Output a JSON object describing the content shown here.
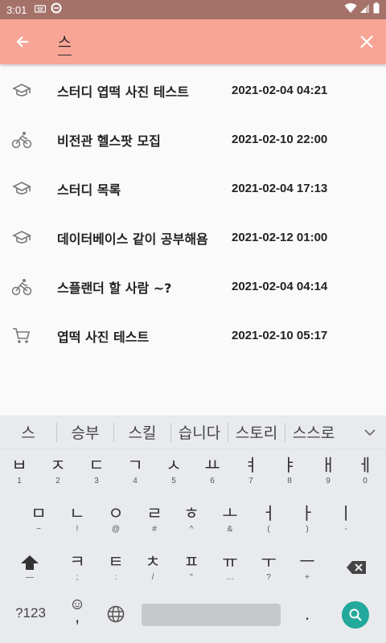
{
  "status_bar": {
    "time": "3:01"
  },
  "search": {
    "query": "스"
  },
  "results": [
    {
      "icon": "graduation-cap-icon",
      "title": "스터디 엽떡 사진 테스트",
      "date": "2021-02-04 04:21"
    },
    {
      "icon": "bicycle-icon",
      "title": "비전관 헬스팟 모집",
      "date": "2021-02-10 22:00"
    },
    {
      "icon": "graduation-cap-icon",
      "title": "스터디 목록",
      "date": "2021-02-04 17:13"
    },
    {
      "icon": "graduation-cap-icon",
      "title": "데이터베이스 같이 공부해욤",
      "date": "2021-02-12 01:00"
    },
    {
      "icon": "bicycle-icon",
      "title": "스플랜더 할 사람 ~?",
      "date": "2021-02-04 04:14"
    },
    {
      "icon": "shopping-cart-icon",
      "title": "엽떡 사진 테스트",
      "date": "2021-02-10 05:17"
    }
  ],
  "keyboard": {
    "suggestions": [
      "스",
      "승부",
      "스킬",
      "습니다",
      "스토리",
      "스스로"
    ],
    "row1": [
      {
        "main": "ㅂ",
        "sub": "1"
      },
      {
        "main": "ㅈ",
        "sub": "2"
      },
      {
        "main": "ㄷ",
        "sub": "3"
      },
      {
        "main": "ㄱ",
        "sub": "4"
      },
      {
        "main": "ㅅ",
        "sub": "5"
      },
      {
        "main": "ㅛ",
        "sub": "6"
      },
      {
        "main": "ㅕ",
        "sub": "7"
      },
      {
        "main": "ㅑ",
        "sub": "8"
      },
      {
        "main": "ㅐ",
        "sub": "9"
      },
      {
        "main": "ㅔ",
        "sub": "0"
      }
    ],
    "row2": [
      {
        "main": "ㅁ",
        "sub": "~"
      },
      {
        "main": "ㄴ",
        "sub": "!"
      },
      {
        "main": "ㅇ",
        "sub": "@"
      },
      {
        "main": "ㄹ",
        "sub": "#"
      },
      {
        "main": "ㅎ",
        "sub": "^"
      },
      {
        "main": "ㅗ",
        "sub": "&"
      },
      {
        "main": "ㅓ",
        "sub": "("
      },
      {
        "main": "ㅏ",
        "sub": ")"
      },
      {
        "main": "ㅣ",
        "sub": "-"
      }
    ],
    "row3": [
      {
        "main": "ㅋ",
        "sub": ";"
      },
      {
        "main": "ㅌ",
        "sub": ":"
      },
      {
        "main": "ㅊ",
        "sub": "/"
      },
      {
        "main": "ㅍ",
        "sub": "\""
      },
      {
        "main": "ㅠ",
        "sub": "…"
      },
      {
        "main": "ㅜ",
        "sub": "?"
      },
      {
        "main": "ㅡ",
        "sub": "+"
      }
    ],
    "shift_sub": "—",
    "symbols_label": "?123",
    "comma_label": ",",
    "period_label": "."
  }
}
